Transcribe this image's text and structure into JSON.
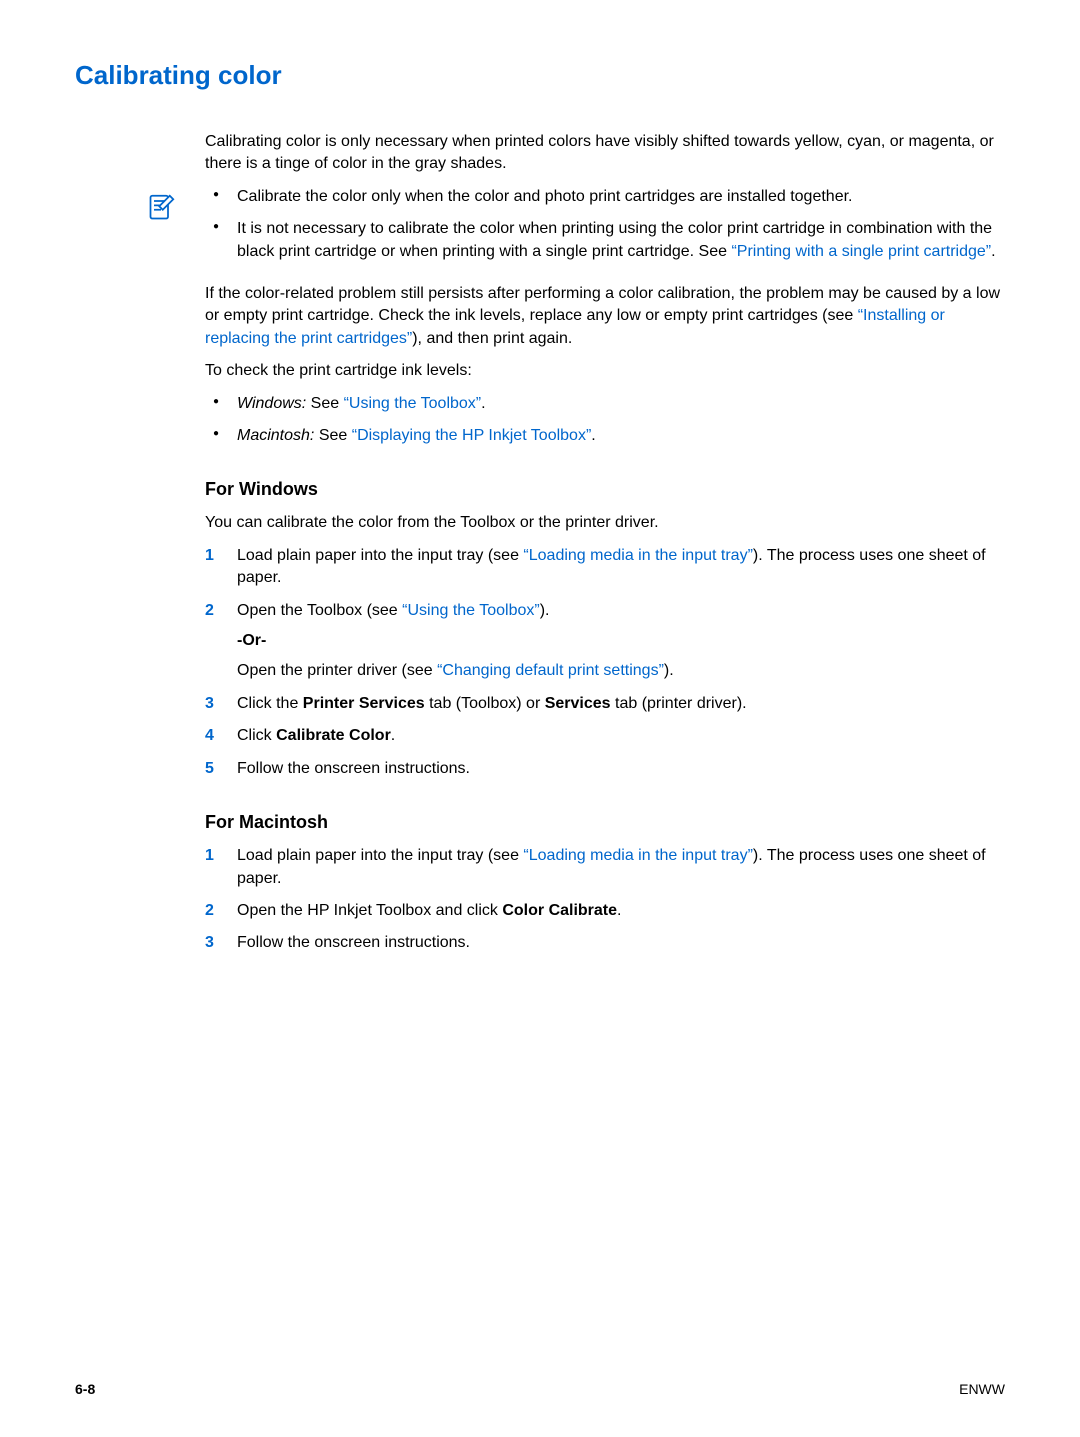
{
  "title": "Calibrating color",
  "intro": "Calibrating color is only necessary when printed colors have visibly shifted towards yellow, cyan, or magenta, or there is a tinge of color in the gray shades.",
  "note": {
    "bullet1": "Calibrate the color only when the color and photo print cartridges are installed together.",
    "bullet2_a": "It is not necessary to calibrate the color when printing using the color print cartridge in combination with the black print cartridge or when printing with a single print cartridge. See ",
    "bullet2_link": "“Printing with a single print cartridge”",
    "bullet2_b": "."
  },
  "para2_a": "If the color-related problem still persists after performing a color calibration, the problem may be caused by a low or empty print cartridge. Check the ink levels, replace any low or empty print cartridges (see ",
  "para2_link": "“Installing or replacing the print cartridges”",
  "para2_b": "), and then print again.",
  "para3": "To check the print cartridge ink levels:",
  "check": {
    "win_label": "Windows:",
    "win_see": " See ",
    "win_link": "“Using the Toolbox”",
    "win_end": ".",
    "mac_label": "Macintosh:",
    "mac_see": " See ",
    "mac_link": "“Displaying the HP Inkjet Toolbox”",
    "mac_end": "."
  },
  "win_heading": "For Windows",
  "win_intro": "You can calibrate the color from the Toolbox or the printer driver.",
  "win_steps": {
    "s1_a": "Load plain paper into the input tray (see ",
    "s1_link": "“Loading media in the input tray”",
    "s1_b": "). The process uses one sheet of paper.",
    "s2_a": "Open the Toolbox (see ",
    "s2_link": "“Using the Toolbox”",
    "s2_b": ").",
    "s2_or": "-Or-",
    "s2_c": "Open the printer driver (see ",
    "s2_c_link": "“Changing default print settings”",
    "s2_c_end": ").",
    "s3_a": "Click the ",
    "s3_b1": "Printer Services",
    "s3_c": " tab (Toolbox) or ",
    "s3_b2": "Services",
    "s3_d": " tab (printer driver).",
    "s4_a": "Click ",
    "s4_b": "Calibrate Color",
    "s4_c": ".",
    "s5": "Follow the onscreen instructions."
  },
  "mac_heading": "For Macintosh",
  "mac_steps": {
    "s1_a": "Load plain paper into the input tray (see ",
    "s1_link": "“Loading media in the input tray”",
    "s1_b": "). The process uses one sheet of paper.",
    "s2_a": "Open the HP Inkjet Toolbox and click ",
    "s2_b": "Color Calibrate",
    "s2_c": ".",
    "s3": "Follow the onscreen instructions."
  },
  "footer": {
    "page": "6-8",
    "brand": "ENWW"
  },
  "nums": {
    "n1": "1",
    "n2": "2",
    "n3": "3",
    "n4": "4",
    "n5": "5"
  }
}
